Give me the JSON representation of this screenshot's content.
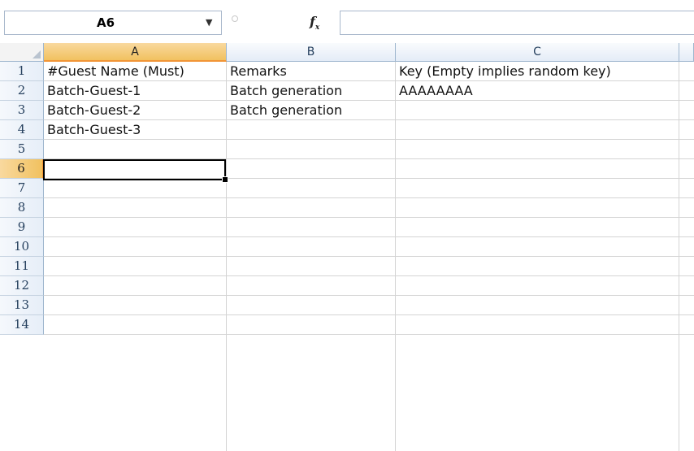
{
  "formula_bar": {
    "name_box": "A6",
    "fx_label": "f",
    "fx_sub": "x",
    "formula": ""
  },
  "columns": [
    "A",
    "B",
    "C"
  ],
  "active_column": "A",
  "rows": [
    "1",
    "2",
    "3",
    "4",
    "5",
    "6",
    "7",
    "8",
    "9",
    "10",
    "11",
    "12",
    "13",
    "14"
  ],
  "active_row": "6",
  "cells": {
    "A1": "#Guest Name (Must)",
    "B1": "Remarks",
    "C1": "Key (Empty implies random key)",
    "A2": "Batch-Guest-1",
    "B2": "Batch generation",
    "C2": "AAAAAAAA",
    "A3": "Batch-Guest-2",
    "B3": "Batch generation",
    "A4": "Batch-Guest-3"
  },
  "colors": {
    "header_bg": "#e4ecf7",
    "active_header_bg": "#f1c15f",
    "gridline": "#d4d4d4",
    "header_border": "#9eb6ce"
  }
}
